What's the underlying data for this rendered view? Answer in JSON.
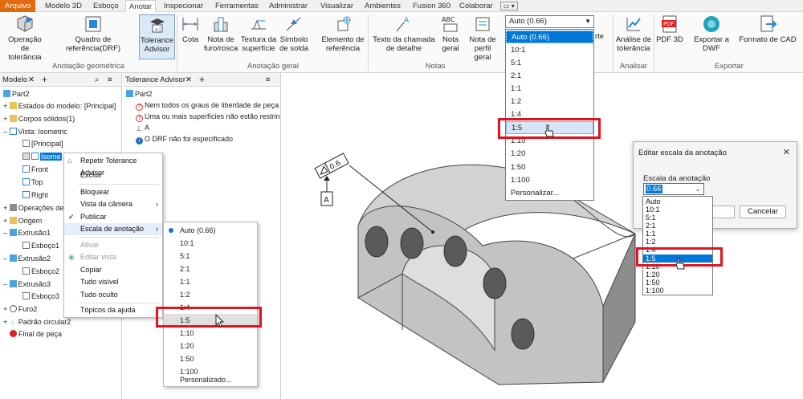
{
  "menu_tabs": [
    "Arquivo",
    "Modelo 3D",
    "Esboço",
    "Anotar",
    "Inspecionar",
    "Ferramentas",
    "Administrar",
    "Visualizar",
    "Ambientes",
    "Fusion 360",
    "Colaborar"
  ],
  "ribbon": {
    "buttons": [
      {
        "label": "Operação de tolerância",
        "icon": "tolerance-feature-icon"
      },
      {
        "label": "Quadro de referência(DRF)",
        "icon": "datum-frame-icon"
      },
      {
        "label": "Tolerance Advisor",
        "icon": "tolerance-advisor-icon"
      },
      {
        "label": "Cota",
        "icon": "dimension-icon"
      },
      {
        "label": "Nota de furo/rosca",
        "icon": "hole-note-icon"
      },
      {
        "label": "Textura da superfície",
        "icon": "surface-texture-icon"
      },
      {
        "label": "Símbolo de solda",
        "icon": "weld-symbol-icon"
      },
      {
        "label": "Elemento de referência",
        "icon": "datum-element-icon"
      },
      {
        "label": "Texto da chamada de detalhe",
        "icon": "leader-text-icon"
      },
      {
        "label": "Nota geral",
        "icon": "general-note-icon"
      },
      {
        "label": "Nota de perfil geral",
        "icon": "profile-note-icon"
      },
      {
        "label": "Análise de tolerância",
        "icon": "tolerance-analysis-icon"
      },
      {
        "label": "PDF 3D",
        "icon": "pdf-icon"
      },
      {
        "label": "Exportar a DWF",
        "icon": "dwf-icon"
      },
      {
        "label": "Formato de CAD",
        "icon": "cad-export-icon"
      }
    ],
    "groups": [
      "Anotação geométrica",
      "Anotação geral",
      "Notas",
      "Analisar",
      "Exportar"
    ],
    "scale_combo": "Auto (0.66)",
    "partial_label": "rte"
  },
  "model_panel": {
    "title": "Modelo",
    "tree": [
      "Part2",
      "Estados do modelo: [Principal]",
      "Corpos sólidos(1)",
      "Vista: Isometric",
      "[Principal]",
      "Isome",
      "Front",
      "Top",
      "Right",
      "Operações de",
      "Origem",
      "Extrusão1",
      "Esboço1",
      "Extrusão2",
      "Esboço2",
      "Extrusão3",
      "Esboço3",
      "Furo2",
      "Padrão circular2",
      "Final de peça"
    ]
  },
  "advisor_panel": {
    "title": "Tolerance Advisor",
    "items": [
      "Part2",
      "Nem todos os graus de liberdade de peça",
      "Uma ou mais superfícies não estão restrin",
      "A",
      "O DRF não foi especificado"
    ]
  },
  "context_menu": {
    "items": [
      "Repetir Tolerance Advisor",
      "Excluir",
      "Bloquear",
      "Vista da câmera",
      "Publicar",
      "Escala de anotação",
      "Ativar",
      "Editar vista",
      "Copiar",
      "Tudo visível",
      "Tudo oculto",
      "Tópicos da ajuda"
    ]
  },
  "submenu": {
    "items": [
      "Auto (0.66)",
      "10:1",
      "5:1",
      "2:1",
      "1:1",
      "1:2",
      "1:4",
      "1:5",
      "1:10",
      "1:20",
      "1:50",
      "1:100",
      "Personalizado..."
    ]
  },
  "dropdown": {
    "items": [
      "Auto (0.66)",
      "10:1",
      "5:1",
      "2:1",
      "1:1",
      "1:2",
      "1:4",
      "1:5",
      "1:10",
      "1:20",
      "1:50",
      "1:100",
      "Personalizar..."
    ]
  },
  "dialog": {
    "title": "Editar escala da anotação",
    "label": "Escala da anotação",
    "value": "0.66",
    "cancel": "Cancelar",
    "list": [
      "Auto",
      "10:1",
      "5:1",
      "2:1",
      "1:1",
      "1:2",
      "1:4",
      "1:5",
      "1:10",
      "1:20",
      "1:50",
      "1:100"
    ]
  },
  "viewport": {
    "frame_value": "0.6",
    "datum_label": "A"
  },
  "colors": {
    "accent": "#0078d7",
    "file_tab": "#e06a10",
    "highlight": "#e0141e"
  }
}
